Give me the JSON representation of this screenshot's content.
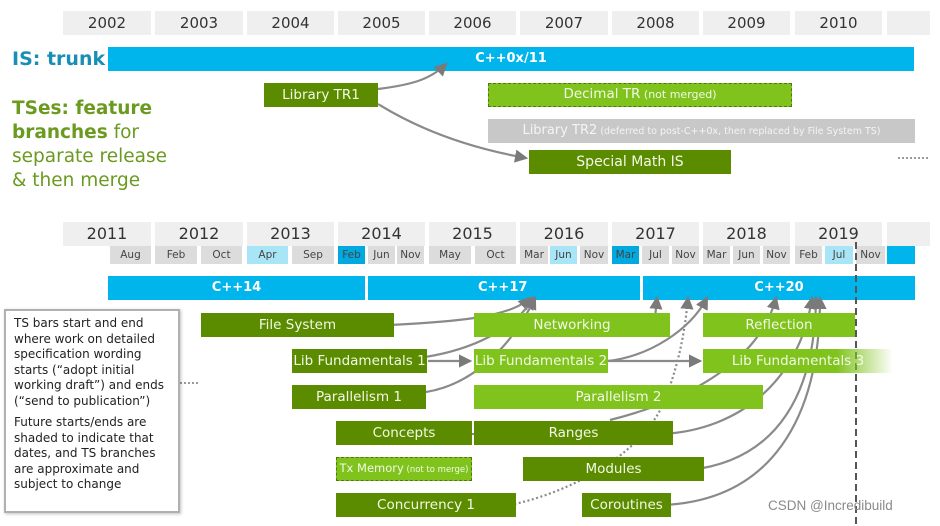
{
  "top_timeline": {
    "years": [
      "2002",
      "2003",
      "2004",
      "2005",
      "2006",
      "2007",
      "2008",
      "2009",
      "2010",
      ""
    ]
  },
  "labels": {
    "is_trunk": "IS: trunk",
    "ts_line1_bold": "TSes: feature",
    "ts_line2_bold": "branches",
    "ts_line2_rest": " for",
    "ts_line3": "separate release",
    "ts_line4": "& then merge"
  },
  "top_bars": {
    "trunk": "C++0x/11",
    "library_tr1": "Library TR1",
    "decimal_tr": "Decimal TR",
    "decimal_tr_note": " (not merged)",
    "library_tr2": "Library TR2",
    "library_tr2_note": " (deferred to post-C++0x, then replaced by File System TS)",
    "special_math": "Special Math IS"
  },
  "bottom_timeline": {
    "years": [
      "2011",
      "2012",
      "2013",
      "2014",
      "2015",
      "2016",
      "2017",
      "2018",
      "2019",
      ""
    ],
    "months": [
      {
        "label": "Aug",
        "state": "normal"
      },
      {
        "label": "Feb",
        "state": "normal"
      },
      {
        "label": "Oct",
        "state": "normal"
      },
      {
        "label": "Apr",
        "state": "light"
      },
      {
        "label": "Sep",
        "state": "normal"
      },
      {
        "label": "Feb",
        "state": "dark"
      },
      {
        "label": "Jun",
        "state": "normal"
      },
      {
        "label": "Nov",
        "state": "normal"
      },
      {
        "label": "May",
        "state": "normal"
      },
      {
        "label": "Oct",
        "state": "normal"
      },
      {
        "label": "Mar",
        "state": "normal"
      },
      {
        "label": "Jun",
        "state": "light"
      },
      {
        "label": "Nov",
        "state": "normal"
      },
      {
        "label": "Mar",
        "state": "dark"
      },
      {
        "label": "Jul",
        "state": "normal"
      },
      {
        "label": "Nov",
        "state": "normal"
      },
      {
        "label": "Mar",
        "state": "normal"
      },
      {
        "label": "Jun",
        "state": "normal"
      },
      {
        "label": "Nov",
        "state": "normal"
      },
      {
        "label": "Feb",
        "state": "normal"
      },
      {
        "label": "Jul",
        "state": "light"
      },
      {
        "label": "Nov",
        "state": "normal"
      },
      {
        "label": "",
        "state": "blank"
      }
    ]
  },
  "standards": {
    "cpp14": "C++14",
    "cpp17": "C++17",
    "cpp20": "C++20"
  },
  "ts_bars": {
    "file_system": "File System",
    "networking": "Networking",
    "reflection": "Reflection",
    "lib_fund_1": "Lib Fundamentals 1",
    "lib_fund_2": "Lib Fundamentals 2",
    "lib_fund_3": "Lib Fundamentals 3",
    "parallelism_1": "Parallelism 1",
    "parallelism_2": "Parallelism 2",
    "concepts": "Concepts",
    "ranges": "Ranges",
    "tx_memory": "Tx Memory",
    "tx_memory_note": " (not to merge)",
    "modules": "Modules",
    "concurrency_1": "Concurrency 1",
    "coroutines": "Coroutines"
  },
  "note": {
    "para1": "TS bars start and end where work on detailed specification wording starts (“adopt initial working draft”) and ends (“send to publication”)",
    "para2": "Future starts/ends are shaded to indicate that dates, and TS branches are approximate and subject to change"
  },
  "watermark": "CSDN @Incredibuild",
  "colors": {
    "trunk_blue": "#00b4ec",
    "dark_green": "#5b8c00",
    "light_green": "#7fc31c",
    "is_label": "#1a8fb5",
    "ts_label": "#6a9a1f"
  }
}
